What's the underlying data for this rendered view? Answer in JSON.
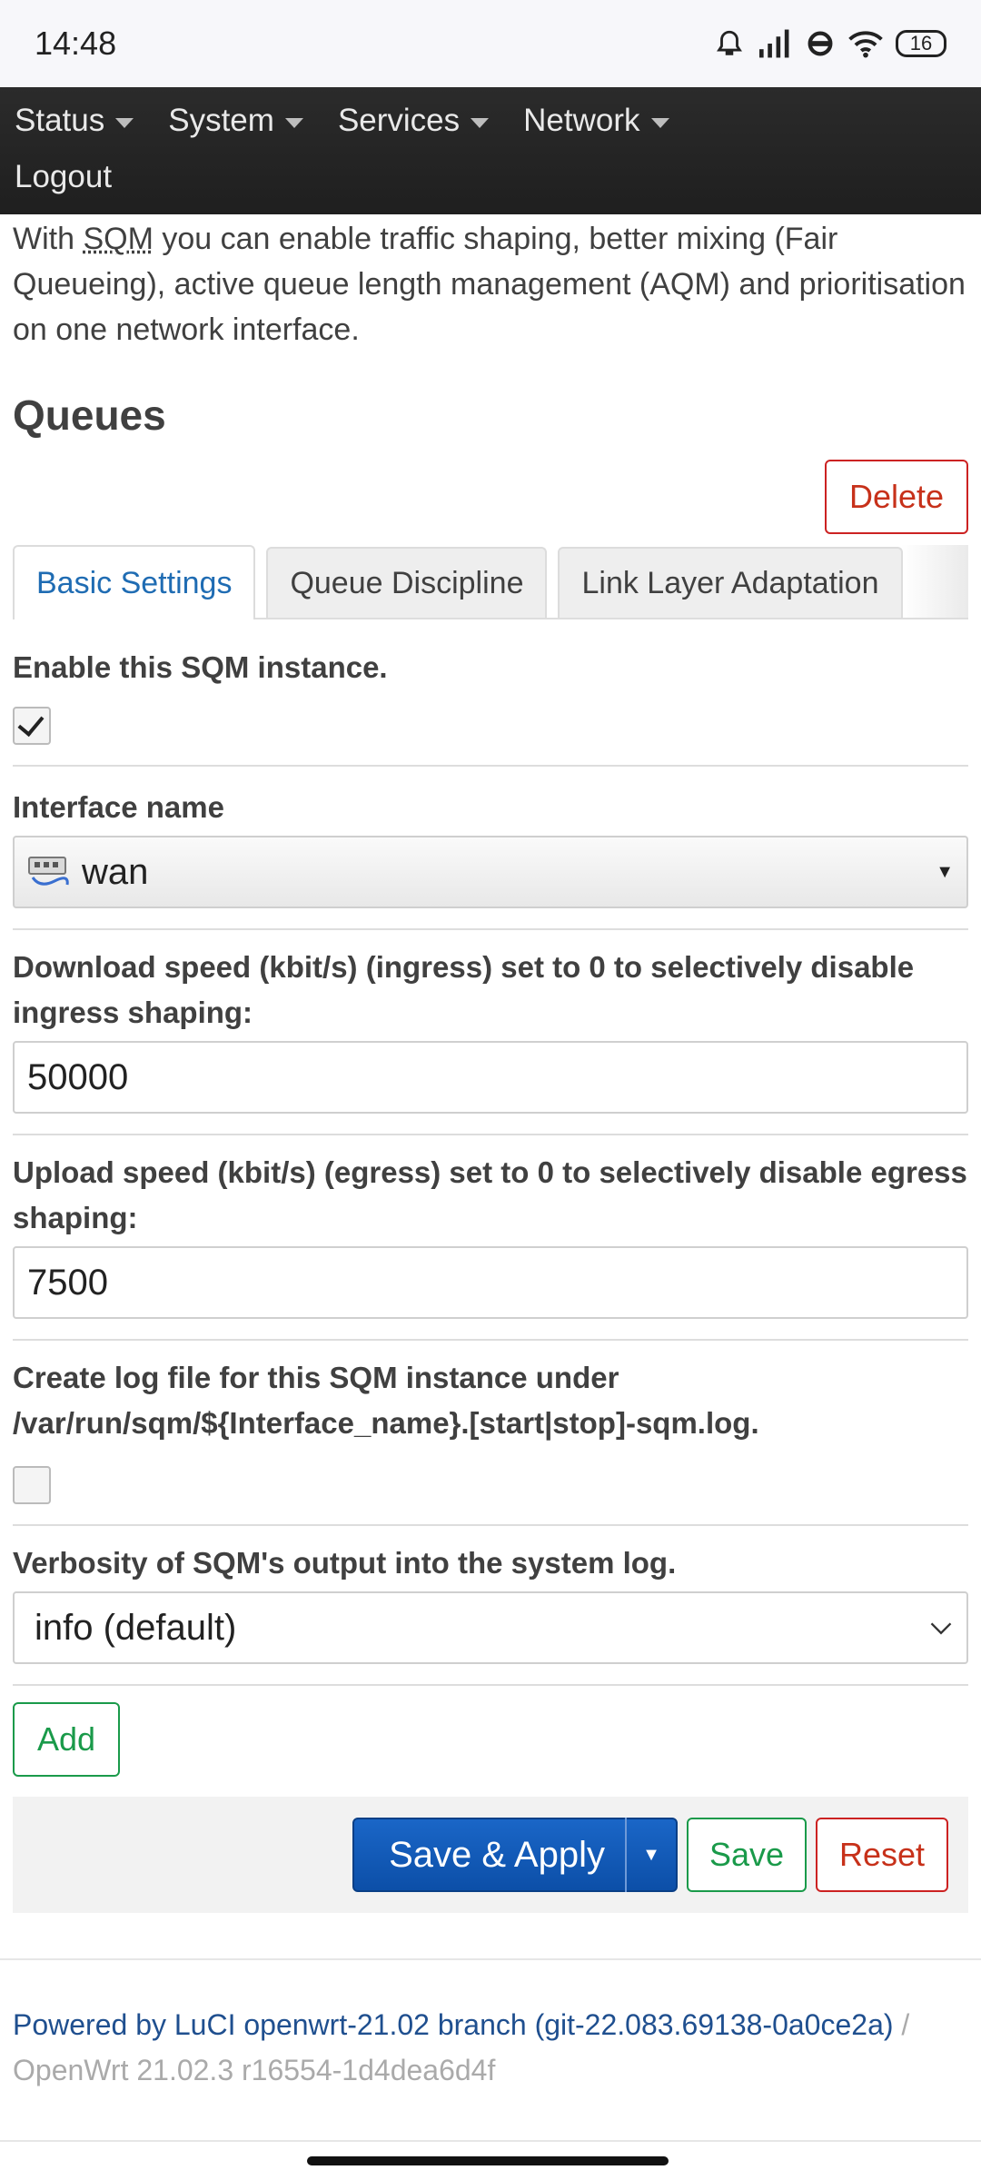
{
  "status_bar": {
    "time": "14:48",
    "battery": "16"
  },
  "nav": {
    "items": [
      "Status",
      "System",
      "Services",
      "Network"
    ],
    "logout": "Logout"
  },
  "intro": {
    "prefix": "With ",
    "abbr": "SQM",
    "suffix": " you can enable traffic shaping, better mixing (Fair Queueing), active queue length management (AQM) and prioritisation on one network interface."
  },
  "section": {
    "title": "Queues",
    "delete_label": "Delete"
  },
  "tabs": [
    {
      "label": "Basic Settings",
      "active": true
    },
    {
      "label": "Queue Discipline",
      "active": false
    },
    {
      "label": "Link Layer Adaptation",
      "active": false
    }
  ],
  "form": {
    "enable_label": "Enable this SQM instance.",
    "enable_checked": true,
    "interface_label": "Interface name",
    "interface_value": "wan",
    "download_label": "Download speed (kbit/s) (ingress) set to 0 to selectively disable ingress shaping:",
    "download_value": "50000",
    "upload_label": "Upload speed (kbit/s) (egress) set to 0 to selectively disable egress shaping:",
    "upload_value": "7500",
    "log_label": "Create log file for this SQM instance under /var/run/sqm/${Interface_name}.[start|stop]-sqm.log.",
    "log_checked": false,
    "verbosity_label": "Verbosity of SQM's output into the system log.",
    "verbosity_value": "info (default)"
  },
  "buttons": {
    "add": "Add",
    "save_apply": "Save & Apply",
    "save": "Save",
    "reset": "Reset"
  },
  "footer": {
    "powered_by": "Powered by LuCI openwrt-21.02 branch (git-22.083.69138-0a0ce2a)",
    "separator": "/",
    "version": "OpenWrt 21.02.3 r16554-1d4dea6d4f"
  },
  "colors": {
    "nav_bg": "#222222",
    "accent_blue": "#1f6cb3",
    "negative_red": "#c7311a",
    "positive_green": "#1a9a4a",
    "primary_button": "#0c4fa8"
  }
}
